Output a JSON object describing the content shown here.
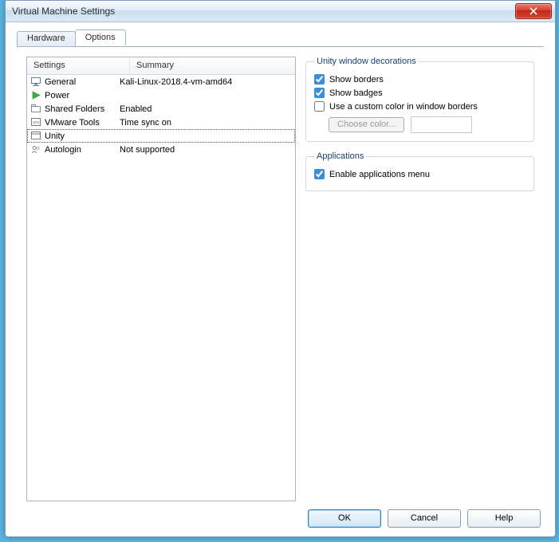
{
  "window": {
    "title": "Virtual Machine Settings"
  },
  "tabs": {
    "hardware": "Hardware",
    "options": "Options"
  },
  "list": {
    "headers": {
      "settings": "Settings",
      "summary": "Summary"
    },
    "rows": [
      {
        "label": "General",
        "summary": "Kali-Linux-2018.4-vm-amd64"
      },
      {
        "label": "Power",
        "summary": ""
      },
      {
        "label": "Shared Folders",
        "summary": "Enabled"
      },
      {
        "label": "VMware Tools",
        "summary": "Time sync on"
      },
      {
        "label": "Unity",
        "summary": ""
      },
      {
        "label": "Autologin",
        "summary": "Not supported"
      }
    ]
  },
  "unity_group": {
    "legend": "Unity window decorations",
    "show_borders": "Show borders",
    "show_badges": "Show badges",
    "use_custom_color": "Use a custom color in window borders",
    "choose_color": "Choose color..."
  },
  "apps_group": {
    "legend": "Applications",
    "enable_menu": "Enable applications menu"
  },
  "buttons": {
    "ok": "OK",
    "cancel": "Cancel",
    "help": "Help"
  }
}
